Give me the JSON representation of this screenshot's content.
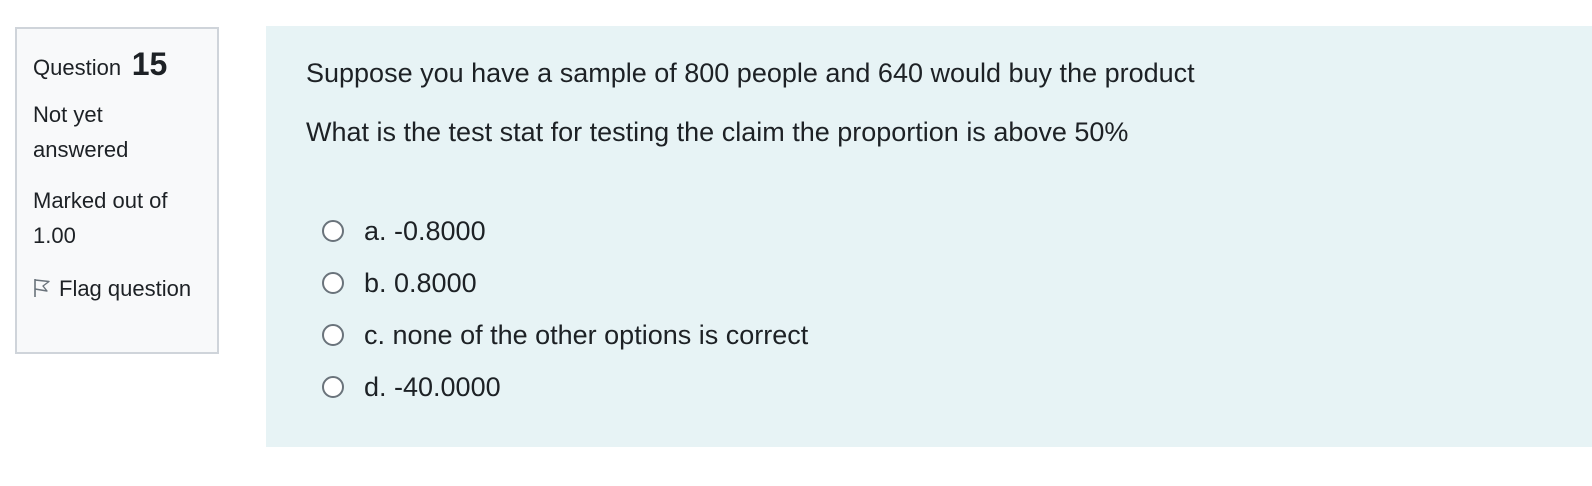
{
  "question_info": {
    "label": "Question",
    "number": "15",
    "state": "Not yet answered",
    "grade": "Marked out of 1.00",
    "flag_label": "Flag question"
  },
  "question": {
    "text_line_1": "Suppose you have a sample of 800 people and 640 would buy the product",
    "text_line_2": "What is the test stat for testing the claim the proportion is above 50%",
    "options": [
      {
        "label": "a. -0.8000"
      },
      {
        "label": "b. 0.8000"
      },
      {
        "label": "c. none of the other options is correct"
      },
      {
        "label": "d. -40.0000"
      }
    ]
  },
  "icons": {
    "flag": "flag-outline-icon",
    "radio": "radio-unchecked-icon"
  },
  "colors": {
    "info_background": "#f8f9fa",
    "info_border": "#cfd4da",
    "content_background": "#e7f3f5",
    "text": "#1d2125"
  }
}
